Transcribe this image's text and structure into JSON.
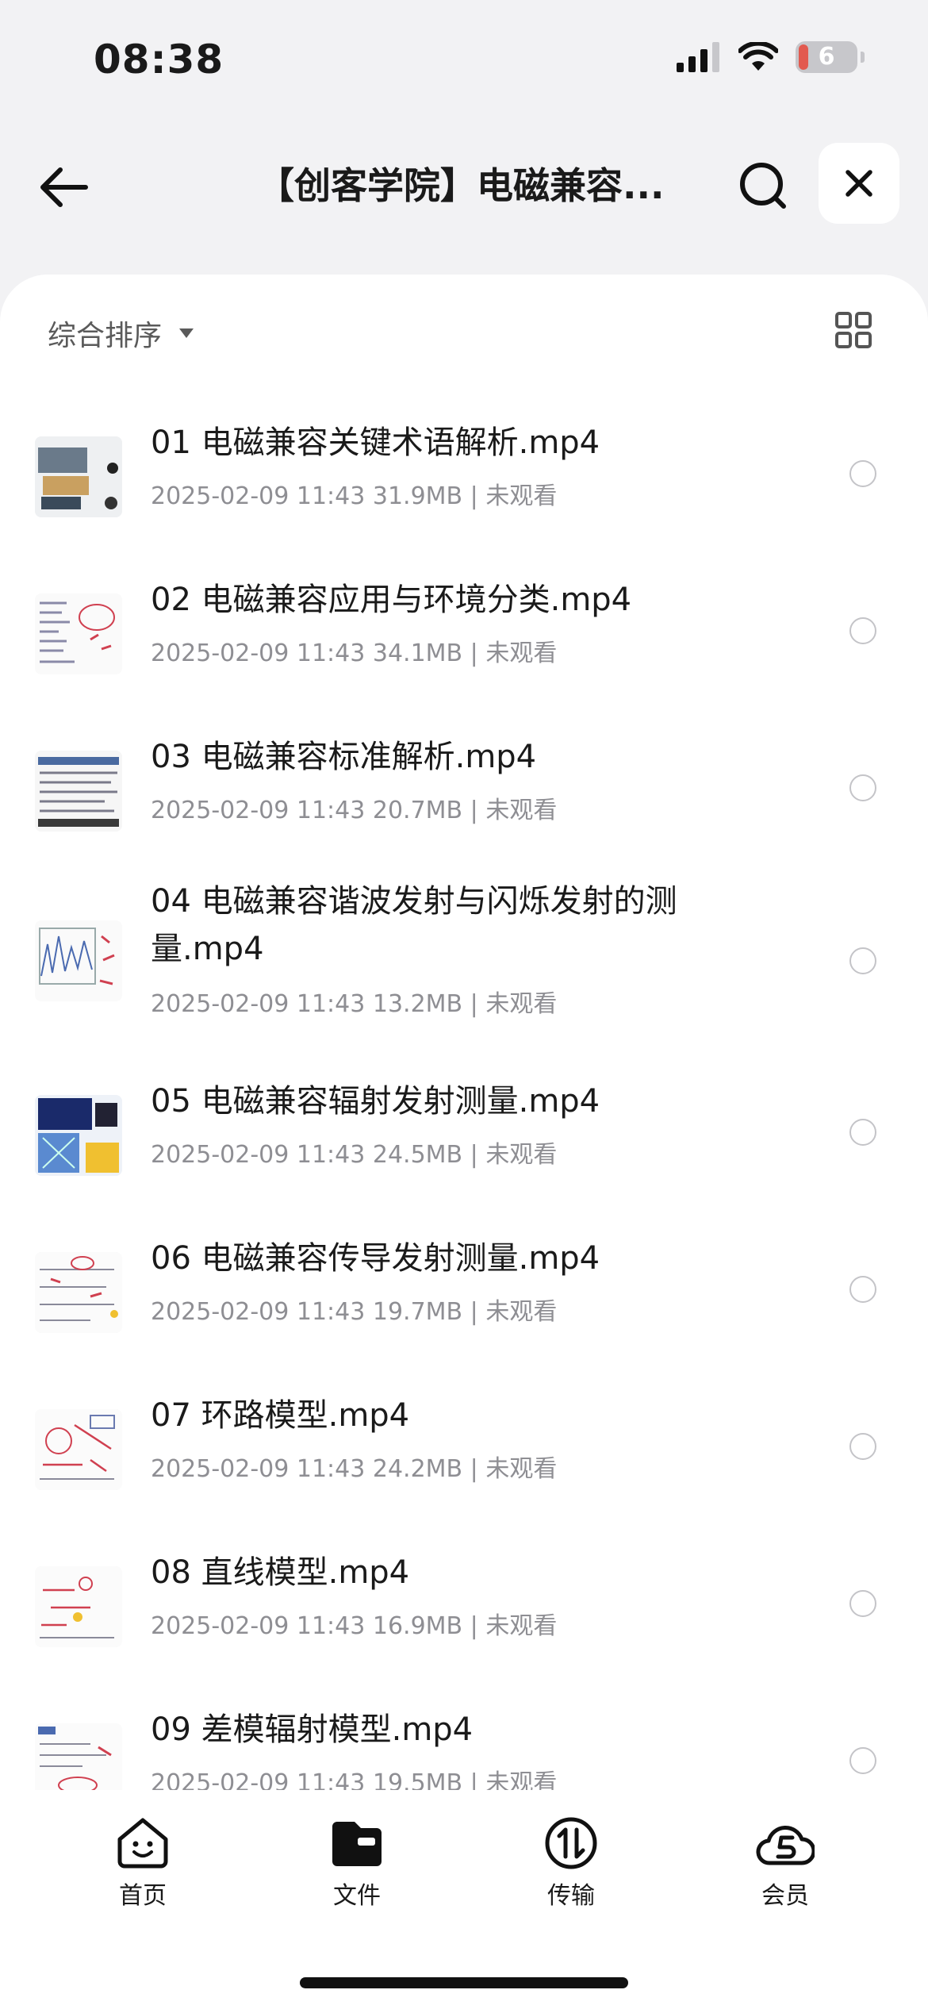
{
  "status": {
    "time": "08:38",
    "battery": "6"
  },
  "header": {
    "title": "【创客学院】电磁兼容..."
  },
  "toolbar": {
    "sort_label": "综合排序"
  },
  "files": [
    {
      "name": "01 电磁兼容关键术语解析.mp4",
      "meta": "2025-02-09 11:43  31.9MB | 未观看"
    },
    {
      "name": "02 电磁兼容应用与环境分类.mp4",
      "meta": "2025-02-09 11:43  34.1MB | 未观看"
    },
    {
      "name": "03 电磁兼容标准解析.mp4",
      "meta": "2025-02-09 11:43  20.7MB | 未观看"
    },
    {
      "name": "04 电磁兼容谐波发射与闪烁发射的测量.mp4",
      "meta": "2025-02-09 11:43  13.2MB | 未观看"
    },
    {
      "name": "05 电磁兼容辐射发射测量.mp4",
      "meta": "2025-02-09 11:43  24.5MB | 未观看"
    },
    {
      "name": "06 电磁兼容传导发射测量.mp4",
      "meta": "2025-02-09 11:43  19.7MB | 未观看"
    },
    {
      "name": "07 环路模型.mp4",
      "meta": "2025-02-09 11:43  24.2MB | 未观看"
    },
    {
      "name": "08 直线模型.mp4",
      "meta": "2025-02-09 11:43  16.9MB | 未观看"
    },
    {
      "name": "09 差模辐射模型.mp4",
      "meta": "2025-02-09 11:43  19.5MB | 未观看"
    }
  ],
  "tabs": [
    {
      "label": "首页",
      "icon": "smile-icon"
    },
    {
      "label": "文件",
      "icon": "folder-icon"
    },
    {
      "label": "传输",
      "icon": "transfer-icon"
    },
    {
      "label": "会员",
      "icon": "cloud-member-icon"
    }
  ]
}
